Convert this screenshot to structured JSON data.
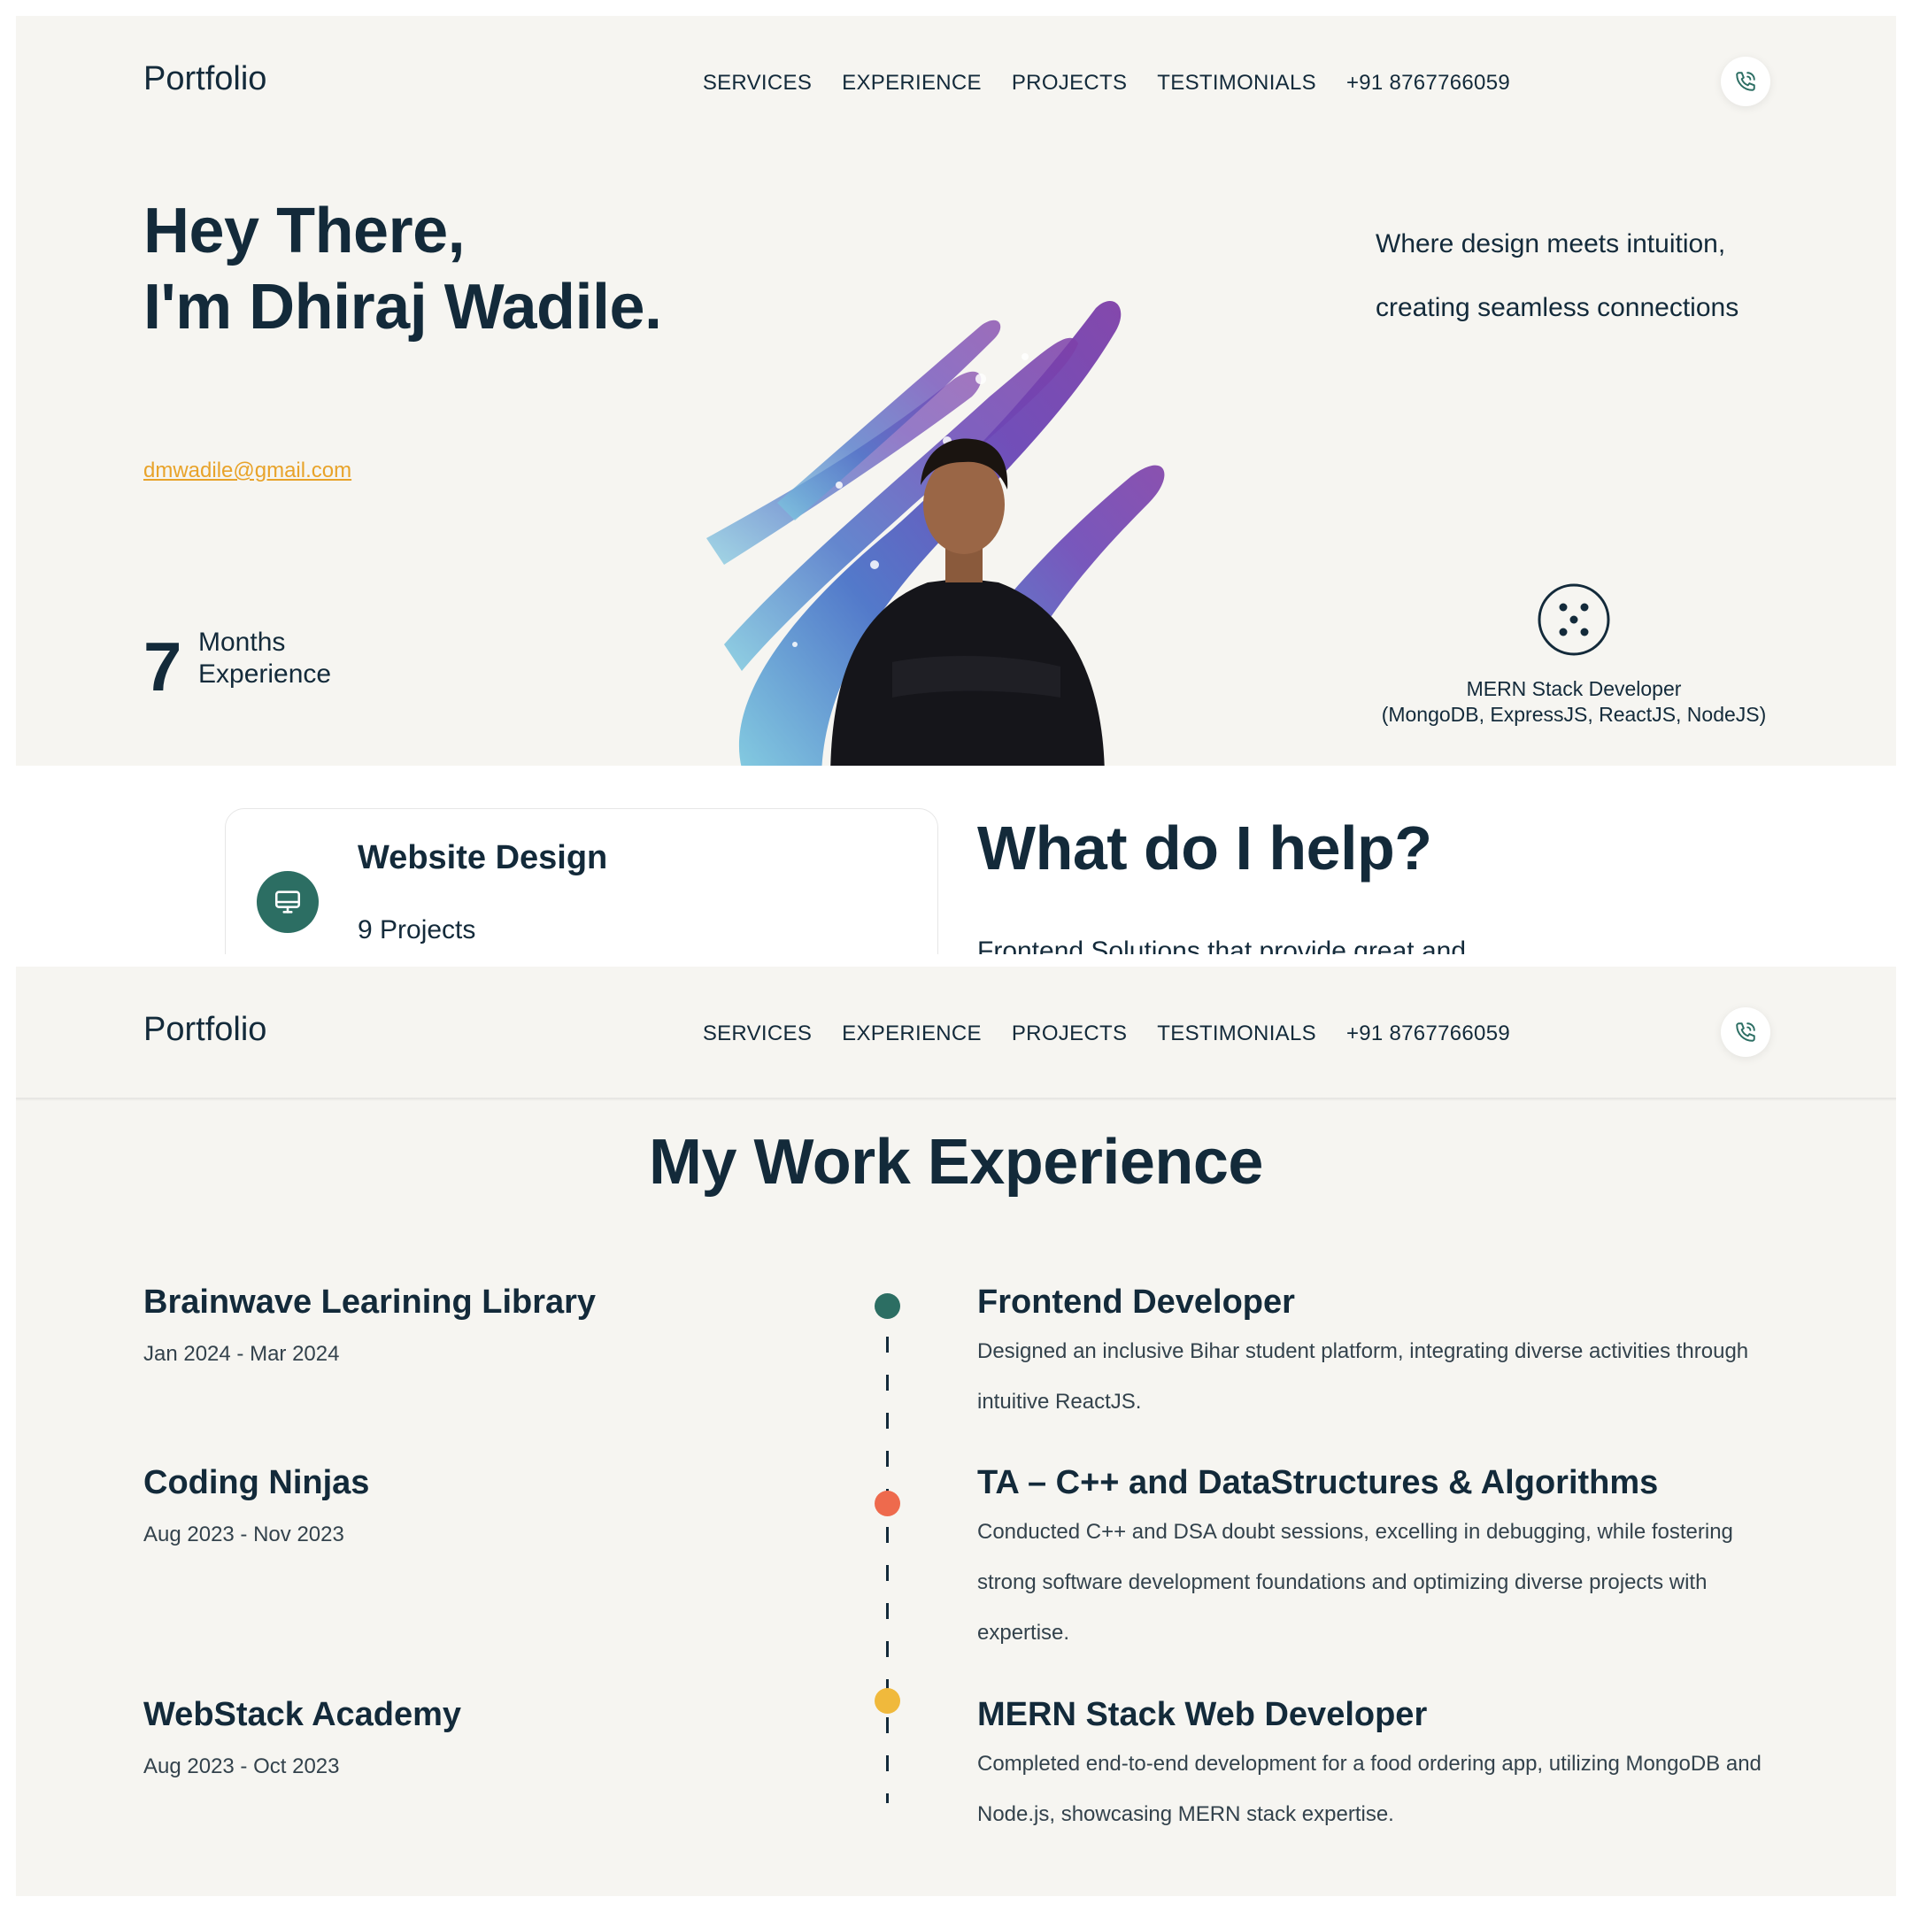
{
  "navbar": {
    "logo": "Portfolio",
    "links": [
      "SERVICES",
      "EXPERIENCE",
      "PROJECTS",
      "TESTIMONIALS",
      "+91 8767766059"
    ]
  },
  "hero": {
    "greeting": "Hey There,",
    "name_line": "I'm Dhiraj Wadile.",
    "email": "dmwadile@gmail.com",
    "experience_number": "7",
    "experience_unit": "Months",
    "experience_label": "Experience",
    "tagline_line1": "Where design meets intuition,",
    "tagline_line2": "creating seamless connections",
    "role_line1": "MERN Stack Developer",
    "role_line2": "(MongoDB, ExpressJS, ReactJS, NodeJS)"
  },
  "services": {
    "card_title": "Website Design",
    "card_count": "9 Projects",
    "heading": "What do I help?",
    "subtext": "Frontend  Solutions that provide great and"
  },
  "experience": {
    "heading": "My Work Experience",
    "items": [
      {
        "company": "Brainwave Learining Library",
        "dates": "Jan 2024 - Mar 2024",
        "role": "Frontend Developer",
        "description": "Designed an inclusive Bihar student platform, integrating diverse activities through intuitive ReactJS.",
        "dot_color": "#2c6e63"
      },
      {
        "company": "Coding Ninjas",
        "dates": "Aug 2023 - Nov 2023",
        "role": "TA – C++ and DataStructures & Algorithms",
        "description": "Conducted C++ and DSA doubt sessions, excelling in debugging, while fostering strong software development foundations and optimizing diverse projects with expertise.",
        "dot_color": "#ee6a4d"
      },
      {
        "company": "WebStack Academy",
        "dates": "Aug 2023 - Oct 2023",
        "role": "MERN Stack Web Developer",
        "description": "Completed end-to-end development for a food ordering app, utilizing MongoDB and Node.js, showcasing MERN stack expertise.",
        "dot_color": "#f0b93c"
      }
    ]
  },
  "colors": {
    "page_bg": "#f6f5f1",
    "text_dark": "#132a3a",
    "accent_email": "#e8a32a",
    "accent_teal": "#2c6e63"
  },
  "icons": {
    "phone": "phone-icon",
    "stack": "dots-circle-icon",
    "service": "monitor-icon"
  }
}
